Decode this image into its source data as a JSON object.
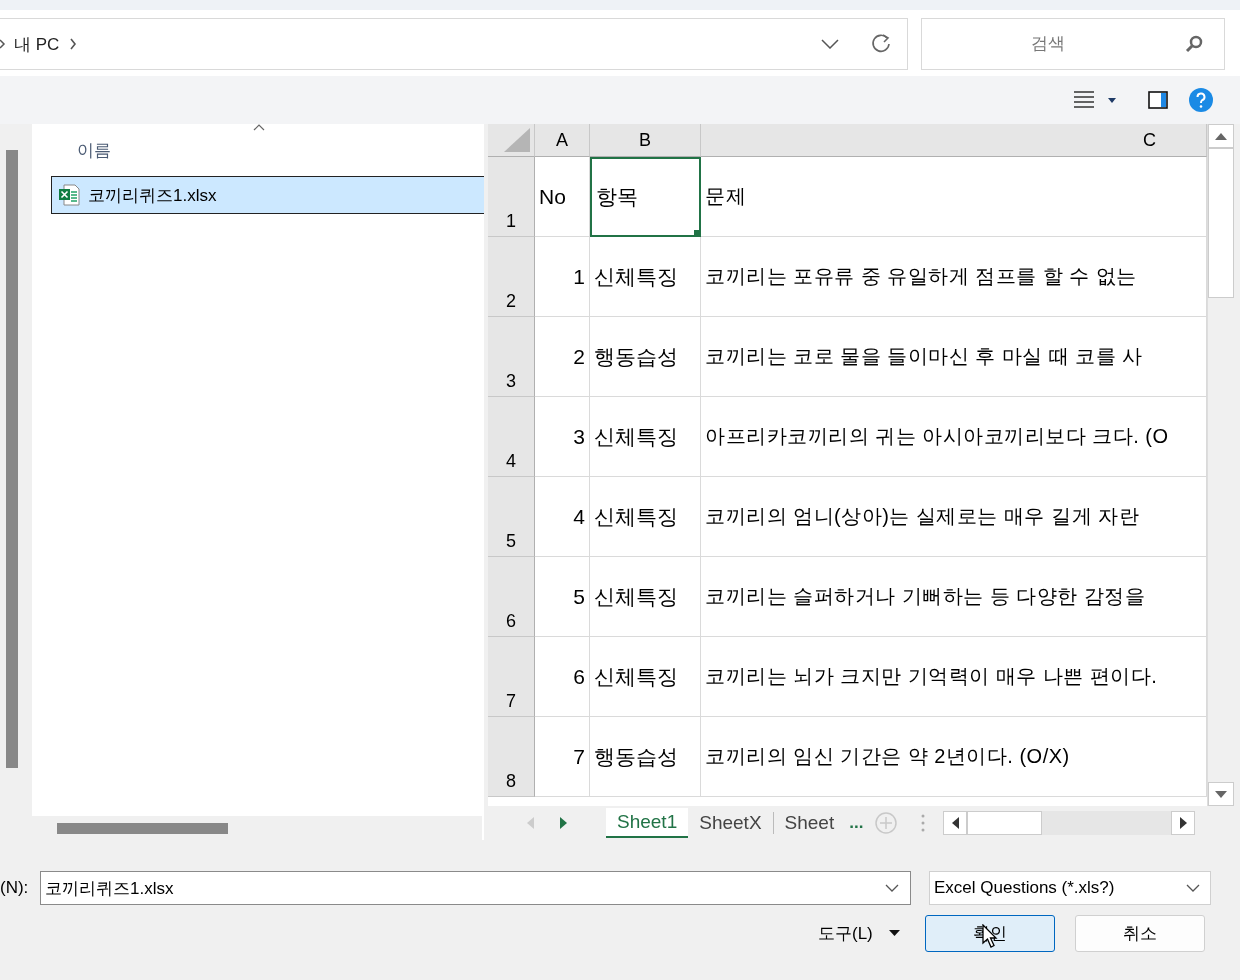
{
  "address_bar": {
    "path": [
      {
        "label": "내 PC"
      }
    ]
  },
  "search": {
    "placeholder": "검색"
  },
  "file_list": {
    "columns": [
      "이름"
    ],
    "items": [
      {
        "name": "코끼리퀴즈1.xlsx",
        "selected": true
      }
    ]
  },
  "preview": {
    "columns": [
      "A",
      "B",
      "C"
    ],
    "rows": [
      {
        "number": "1",
        "cells": [
          {
            "text": "No",
            "kind": "text",
            "selected": false
          },
          {
            "text": "항목",
            "kind": "text",
            "selected": true
          },
          {
            "text": "문제",
            "kind": "text",
            "selected": false
          }
        ]
      },
      {
        "number": "2",
        "cells": [
          {
            "text": "1",
            "kind": "number",
            "selected": false
          },
          {
            "text": "신체특징",
            "kind": "text",
            "selected": false
          },
          {
            "text": "코끼리는 포유류 중 유일하게 점프를 할 수 없는",
            "kind": "text",
            "selected": false
          }
        ]
      },
      {
        "number": "3",
        "cells": [
          {
            "text": "2",
            "kind": "number",
            "selected": false
          },
          {
            "text": "행동습성",
            "kind": "text",
            "selected": false
          },
          {
            "text": "코끼리는 코로 물을 들이마신 후 마실 때 코를 사",
            "kind": "text",
            "selected": false
          }
        ]
      },
      {
        "number": "4",
        "cells": [
          {
            "text": "3",
            "kind": "number",
            "selected": false
          },
          {
            "text": "신체특징",
            "kind": "text",
            "selected": false
          },
          {
            "text": "아프리카코끼리의 귀는 아시아코끼리보다 크다. (O",
            "kind": "text",
            "selected": false
          }
        ]
      },
      {
        "number": "5",
        "cells": [
          {
            "text": "4",
            "kind": "number",
            "selected": false
          },
          {
            "text": "신체특징",
            "kind": "text",
            "selected": false
          },
          {
            "text": "코끼리의 엄니(상아)는 실제로는 매우 길게 자란",
            "kind": "text",
            "selected": false
          }
        ]
      },
      {
        "number": "6",
        "cells": [
          {
            "text": "5",
            "kind": "number",
            "selected": false
          },
          {
            "text": "신체특징",
            "kind": "text",
            "selected": false
          },
          {
            "text": "코끼리는 슬퍼하거나 기뻐하는 등 다양한 감정을",
            "kind": "text",
            "selected": false
          }
        ]
      },
      {
        "number": "7",
        "cells": [
          {
            "text": "6",
            "kind": "number",
            "selected": false
          },
          {
            "text": "신체특징",
            "kind": "text",
            "selected": false
          },
          {
            "text": "코끼리는 뇌가 크지만 기억력이 매우 나쁜 편이다.",
            "kind": "text",
            "selected": false
          }
        ]
      },
      {
        "number": "8",
        "cells": [
          {
            "text": "7",
            "kind": "number",
            "selected": false
          },
          {
            "text": "행동습성",
            "kind": "text",
            "selected": false
          },
          {
            "text": "코끼리의 임신 기간은 약 2년이다. (O/X)",
            "kind": "text",
            "selected": false
          }
        ]
      }
    ],
    "sheet_tabs": [
      {
        "label": "Sheet1",
        "selected": true
      },
      {
        "label": "SheetX",
        "selected": false
      },
      {
        "label": "Sheet",
        "selected": false
      }
    ],
    "more_sheets": "..."
  },
  "file_name": {
    "label": "(N):",
    "value": "코끼리퀴즈1.xlsx"
  },
  "file_type": {
    "value": "Excel Questions (*.xls?)"
  },
  "tools_button": {
    "label": "도구(L)"
  },
  "buttons": [
    {
      "label": "확인",
      "default": true
    },
    {
      "label": "취소",
      "default": false
    }
  ]
}
